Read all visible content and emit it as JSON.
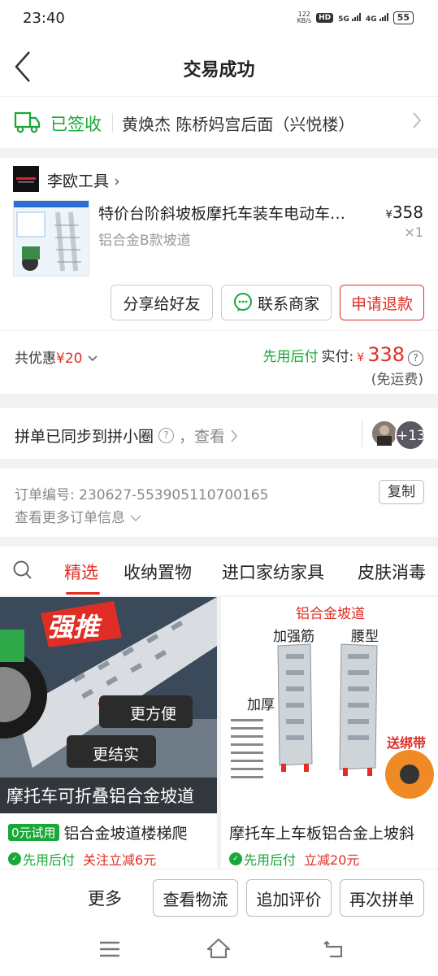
{
  "status_bar": {
    "time": "23:40",
    "net_speed_value": "122",
    "net_speed_unit": "KB/s",
    "hd": "HD",
    "sig1": "5G",
    "sig2": "4G",
    "battery": "55"
  },
  "header": {
    "title": "交易成功",
    "back_icon": "back-arrow-icon"
  },
  "delivery": {
    "status": "已签收",
    "address": "黄焕杰 陈桥妈宫后面（兴悦楼）",
    "status_color": "#19a838"
  },
  "order": {
    "shop_name": "李欧工具",
    "shop_arrow": "›",
    "product_title": "特价台阶斜坡板摩托车装车电动车…",
    "product_spec": "铝合金B款坡道",
    "currency": "¥",
    "price": "358",
    "quantity": "×1",
    "buttons": {
      "share": "分享给好友",
      "contact": "联系商家",
      "refund": "申请退款"
    },
    "discount_label": "共优惠",
    "discount_value": "¥20",
    "pay_later": "先用后付",
    "paid_label": "实付:",
    "paid_currency": "¥",
    "paid_amount": "338",
    "shipping": "(免运费)",
    "accent_color": "#e02e24"
  },
  "group_sync": {
    "text": "拼单已同步到拼小圈",
    "view": "，查看",
    "avatar_count": "+13"
  },
  "order_info": {
    "number_label": "订单编号: ",
    "number": "230627-553905110700165",
    "copy": "复制",
    "more": "查看更多订单信息"
  },
  "tabs": [
    {
      "label": "精选",
      "active": true
    },
    {
      "label": "收纳置物"
    },
    {
      "label": "进口家纺家具"
    },
    {
      "label": "皮肤消毒"
    }
  ],
  "feed": [
    {
      "badge": "0元试用",
      "title": "铝合金坡道楼梯爬",
      "pay_later": "先用后付",
      "promo": "关注立减6元",
      "img_texts": {
        "strong": "强推",
        "tag1": "更方便",
        "tag2": "更结实",
        "caption": "摩托车可折叠铝合金坡道"
      }
    },
    {
      "title": "摩托车上车板铝合金上坡斜",
      "pay_later": "先用后付",
      "promo": "立减20元",
      "img_texts": {
        "head": "铝合金坡道",
        "rib": "加强筋",
        "waist": "腰型",
        "thick": "加厚",
        "strap": "送绑带"
      }
    }
  ],
  "bottom_bar": {
    "more": "更多",
    "logistics": "查看物流",
    "review": "追加评价",
    "rebuy": "再次拼单"
  },
  "nav": {
    "menu": "menu-icon",
    "home": "home-icon",
    "back": "back-icon"
  }
}
